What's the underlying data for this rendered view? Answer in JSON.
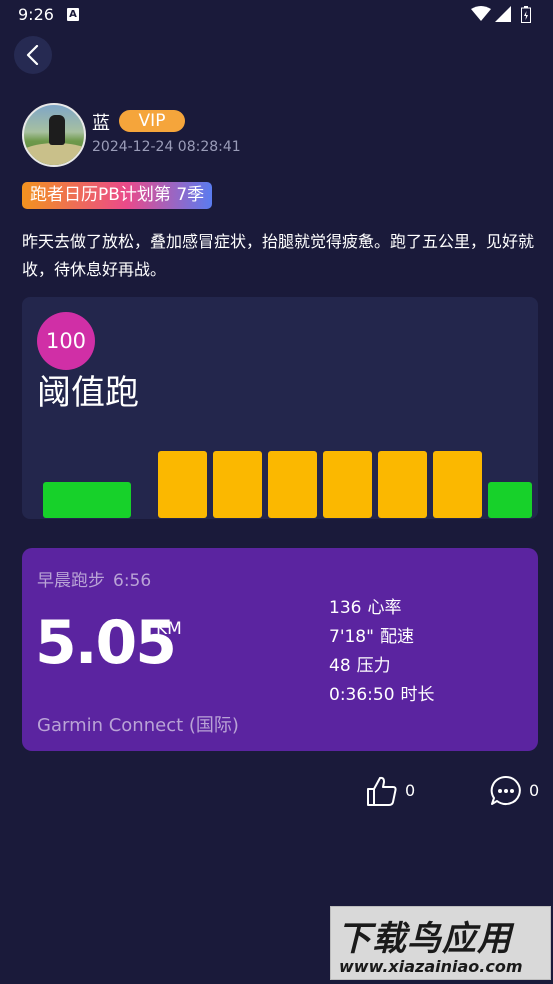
{
  "status_bar": {
    "time": "9:26",
    "notification_icon": "A",
    "icons": [
      "wifi-icon",
      "signal-icon",
      "battery-icon"
    ]
  },
  "nav": {
    "back_icon": "chevron-left-icon"
  },
  "post": {
    "username": "蓝",
    "vip_label": "VIP",
    "timestamp": "2024-12-24 08:28:41",
    "tag": "跑者日历PB计划第 7季",
    "text": "昨天去做了放松，叠加感冒症状，抬腿就觉得疲惫。跑了五公里，见好就收，待休息好再战。"
  },
  "workout": {
    "score": "100",
    "title": "阈值跑",
    "segments": [
      {
        "type": "easy",
        "color": "#17d12a",
        "level": 0.28
      },
      {
        "type": "threshold",
        "color": "#fbb800",
        "level": 0.52
      },
      {
        "type": "threshold",
        "color": "#fbb800",
        "level": 0.52
      },
      {
        "type": "threshold",
        "color": "#fbb800",
        "level": 0.52
      },
      {
        "type": "threshold",
        "color": "#fbb800",
        "level": 0.52
      },
      {
        "type": "threshold",
        "color": "#fbb800",
        "level": 0.52
      },
      {
        "type": "threshold",
        "color": "#fbb800",
        "level": 0.52
      },
      {
        "type": "easy",
        "color": "#17d12a",
        "level": 0.28
      }
    ]
  },
  "activity": {
    "name": "早晨跑步",
    "time": "6:56",
    "distance": "5.05",
    "unit": "KM",
    "stats": [
      {
        "value": "136",
        "label": "心率"
      },
      {
        "value": "7'18\"",
        "label": "配速"
      },
      {
        "value": "48",
        "label": "压力"
      },
      {
        "value": "0:36:50",
        "label": "时长"
      }
    ],
    "source": "Garmin Connect (国际)"
  },
  "actions": {
    "like_count": "0",
    "comment_count": "0"
  },
  "watermark": {
    "logo": "下载鸟应用",
    "url": "www.xiazainiao.com"
  },
  "colors": {
    "background": "#1a1a3a",
    "card": "#23264c",
    "activity_card": "#5b24a0",
    "vip": "#f5a53b",
    "score": "#d02fa6"
  }
}
